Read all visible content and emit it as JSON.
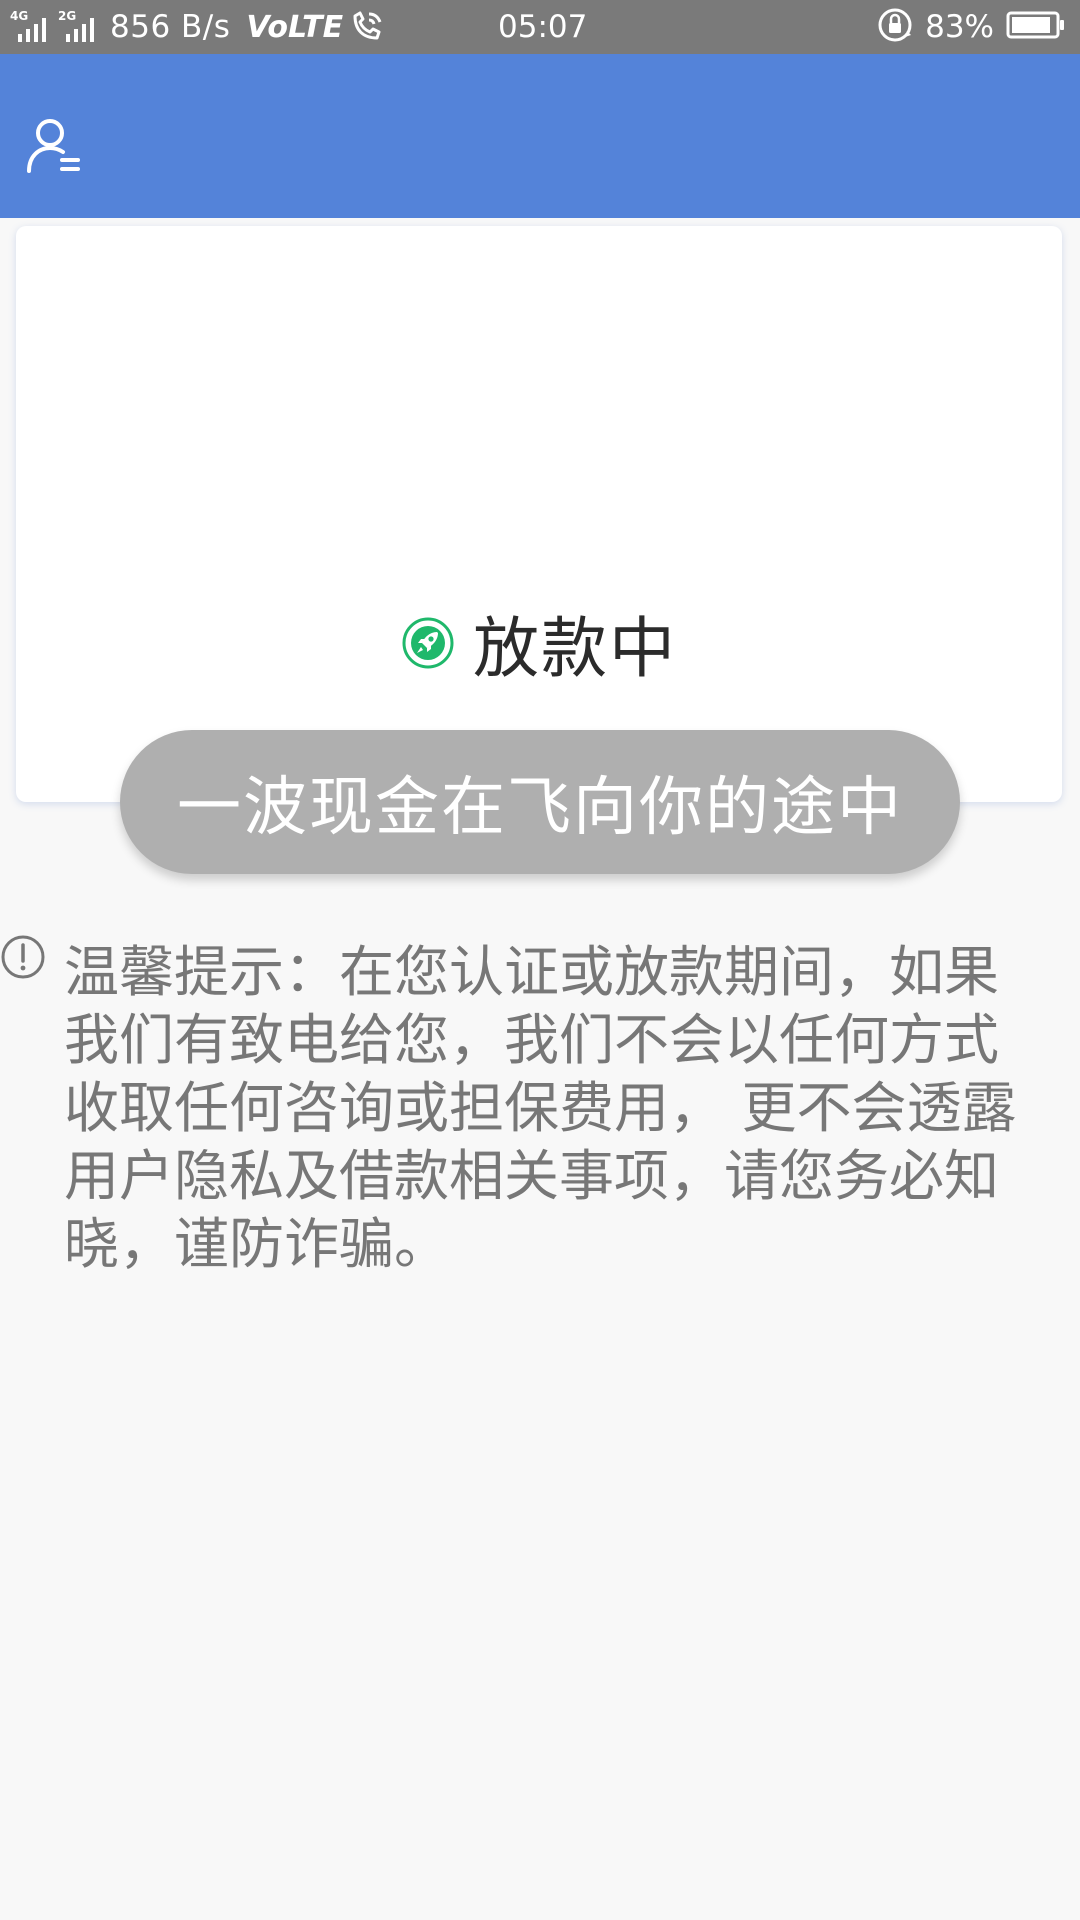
{
  "status_bar": {
    "sim1_label": "4G",
    "sim2_label": "2G",
    "net_speed": "856 B/s",
    "volte": "VoLTE",
    "time": "05:07",
    "battery": "83%",
    "icons": [
      "signal-icon",
      "signal-icon",
      "wifi-calling-icon",
      "rotation-lock-icon",
      "battery-icon"
    ]
  },
  "app_bar": {
    "background": "#5483d9",
    "left_icon": "user-menu-icon"
  },
  "card": {
    "status_icon": "rocket-icon",
    "status_icon_color": "#1fb86b",
    "status_title": "放款中"
  },
  "pill": {
    "text": "一波现金在飞向你的途中",
    "background": "#afafaf"
  },
  "notice": {
    "icon": "exclamation-circle-icon",
    "text": "温馨提示：在您认证或放款期间，如果\n我们有致电给您，我们不会以任何方式\n收取任何咨询或担保费用， 更不会透露\n用户隐私及借款相关事项，请您务必知\n晓，谨防诈骗。"
  }
}
